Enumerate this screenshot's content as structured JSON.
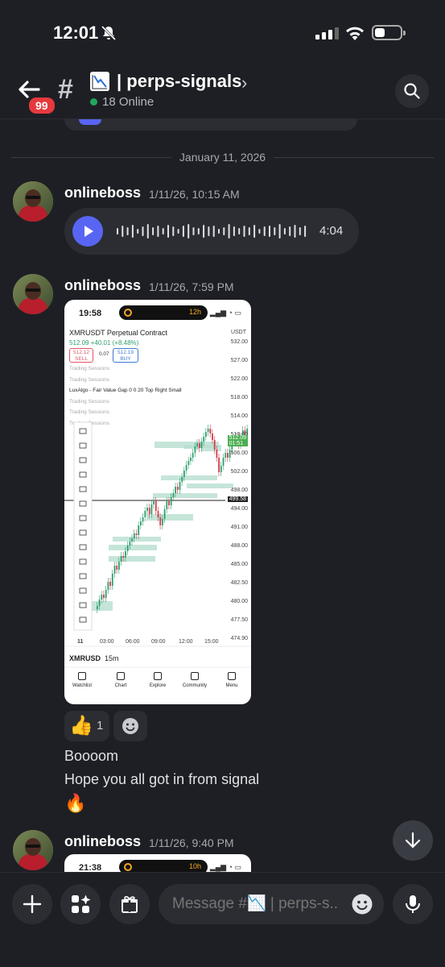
{
  "status": {
    "time": "12:01"
  },
  "header": {
    "back_badge": "99",
    "channel_hash": "#",
    "channel_name": "| perps-signals",
    "chevron": "›",
    "online": "18 Online"
  },
  "date_divider": "January 11, 2026",
  "messages": [
    {
      "author": "onlineboss",
      "time": "1/11/26, 10:15 AM",
      "voice_duration": "4:04"
    },
    {
      "author": "onlineboss",
      "time": "1/11/26, 7:59 PM",
      "reaction": {
        "emoji": "👍",
        "count": "1"
      },
      "lines": [
        "Boooom",
        "Hope you all got in from signal",
        "🔥"
      ]
    },
    {
      "author": "onlineboss",
      "time": "1/11/26, 9:40 PM"
    }
  ],
  "screenshot": {
    "time": "19:58",
    "island_label": "12h",
    "pair": "XMRUSDT Perpetual Contract",
    "price_change": "512.09 +40.01 (+8.48%)",
    "sell_price": "512.12",
    "sell_label": "SELL",
    "spread": "0.07",
    "buy_price": "512.19",
    "buy_label": "BUY",
    "indicators": [
      "Trading Sessions",
      "Trading Sessions",
      "LuxAlgo - Fair Value Gap 0 0 20 Top Right Small",
      "Trading Sessions",
      "Trading Sessions",
      "Trading Sessions"
    ],
    "currency": "USDT",
    "y_ticks": [
      "532.00",
      "527.00",
      "522.00",
      "518.00",
      "514.00",
      "510.00",
      "506.00",
      "502.00",
      "498.00",
      "494.00",
      "491.00",
      "488.00",
      "485.00",
      "482.50",
      "480.00",
      "477.50",
      "474.90"
    ],
    "last_price": "512.09",
    "last_sub": "01:51",
    "crosshair_price": "499.58",
    "x_ticks": [
      "11",
      "03:00",
      "06:00",
      "09:00",
      "12:00",
      "15:00"
    ],
    "symbol": "XMRUSD",
    "timeframe": "15m",
    "nav": [
      "Watchlist",
      "Chart",
      "Explore",
      "Community",
      "Menu"
    ]
  },
  "screenshot2": {
    "time": "21:38",
    "island_label": "10h"
  },
  "composer": {
    "placeholder": "Message #📉 | perps-s.."
  },
  "colors": {
    "accent": "#5865f2",
    "badge": "#e5393d",
    "online": "#23a55a",
    "background": "#1e1f24"
  }
}
